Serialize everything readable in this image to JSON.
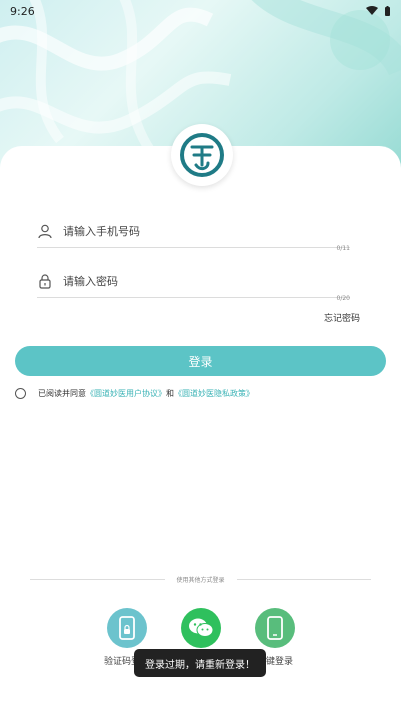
{
  "status_bar": {
    "time": "9:26"
  },
  "login_form": {
    "phone_placeholder": "请输入手机号码",
    "phone_counter": "0/11",
    "password_placeholder": "请输入密码",
    "password_counter": "0/20",
    "forgot_password": "忘记密码",
    "login_button": "登录"
  },
  "agreement": {
    "prefix": "已阅读并同意",
    "user_agreement": "《圆道妙医用户协议》",
    "and": "和",
    "privacy_policy": "《圆道妙医隐私政策》"
  },
  "other_login": {
    "divider_text": "使用其他方式登录",
    "sms_label": "验证码登录",
    "wechat_label": "",
    "oneclick_label": "一键登录"
  },
  "toast": {
    "message": "登录过期，请重新登录！"
  },
  "colors": {
    "accent": "#5cc4c6",
    "link": "#3bb3b6",
    "sms_icon_bg": "#6cc3cd",
    "wechat_icon_bg": "#2fc05d",
    "oneclick_icon_bg": "#58bd7c"
  }
}
